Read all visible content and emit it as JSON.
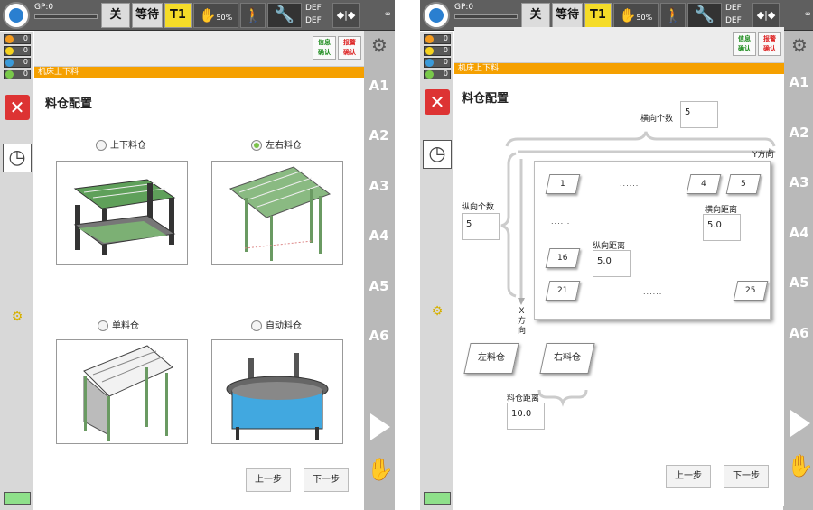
{
  "topbar": {
    "gp_label": "GP:0",
    "btn_off": "关",
    "btn_wait": "等待",
    "btn_mode": "T1",
    "speed": "50%",
    "def1": "DEF",
    "def2": "DEF",
    "inf": "∞"
  },
  "left_leds": [
    {
      "color": "#f39a1e",
      "count": "0"
    },
    {
      "color": "#f5d21e",
      "count": "0"
    },
    {
      "color": "#3a9ad9",
      "count": "0"
    },
    {
      "color": "#79c94a",
      "count": "0"
    }
  ],
  "axes": [
    "A1",
    "A2",
    "A3",
    "A4",
    "A5",
    "A6"
  ],
  "toolstrip": {
    "btn_green": [
      "信息",
      "确认"
    ],
    "btn_red": [
      "报警",
      "确认"
    ]
  },
  "breadcrumb": "机床上下料",
  "title": "料仓配置",
  "left_screen": {
    "options": [
      {
        "label": "上下料仓",
        "selected": false
      },
      {
        "label": "左右料仓",
        "selected": true
      },
      {
        "label": "单料仓",
        "selected": false
      },
      {
        "label": "自动料仓",
        "selected": false
      }
    ],
    "prev": "上一步",
    "next": "下一步"
  },
  "right_screen": {
    "h_count_label": "横向个数",
    "h_count_value": "5",
    "y_dir": "Y方向",
    "v_count_label": "纵向个数",
    "v_count_value": "5",
    "x_dir": [
      "X",
      "方",
      "向"
    ],
    "cells": [
      "1",
      "4",
      "5",
      "16",
      "21",
      "25"
    ],
    "dots": "......",
    "h_dist_label": "横向距离",
    "h_dist_value": "5.0",
    "v_dist_label": "纵向距离",
    "v_dist_value": "5.0",
    "left_bin": "左料仓",
    "right_bin": "右料仓",
    "bin_dist_label": "料仓距离",
    "bin_dist_value": "10.0",
    "prev": "上一步",
    "next": "下一步"
  }
}
